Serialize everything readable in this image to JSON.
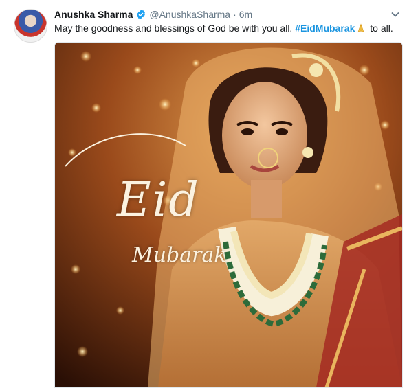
{
  "tweet": {
    "author_name": "Anushka Sharma",
    "handle": "@AnushkaSharma",
    "separator": "·",
    "time": "6m",
    "text_before": "May the goodness and blessings of God be with you all.",
    "hashtag": "#EidMubarak",
    "emoji_icon": "folded-hands-emoji",
    "text_after": "to all."
  },
  "media": {
    "overlay_title": "Eid",
    "overlay_subtitle": "Mubarak"
  },
  "colors": {
    "hashtag": "#1b95e0",
    "verified": "#1da1f2",
    "muted_text": "#657786"
  }
}
